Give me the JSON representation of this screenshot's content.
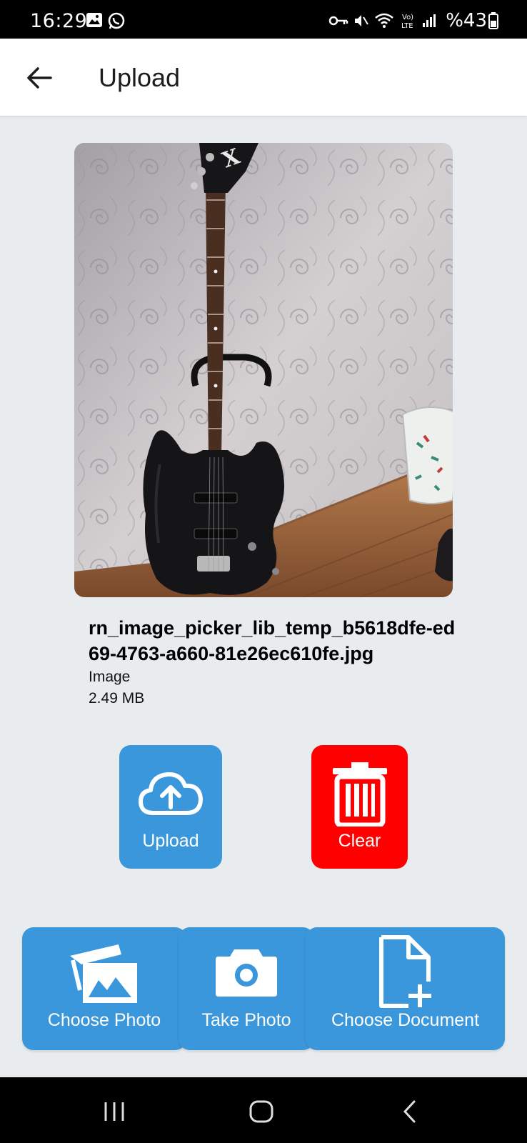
{
  "status_bar": {
    "time": "16:29",
    "battery": "%43",
    "icons": [
      "gallery-icon",
      "whatsapp-icon",
      "vpn-key-icon",
      "mute-icon",
      "wifi-icon",
      "volte-icon",
      "signal-icon",
      "battery-icon"
    ]
  },
  "header": {
    "title": "Upload",
    "back_icon": "arrow-left-icon"
  },
  "file": {
    "name": "rn_image_picker_lib_temp_b5618dfe-ed69-4763-a660-81e26ec610fe.jpg",
    "type": "Image",
    "size": "2.49 MB"
  },
  "actions": {
    "upload_label": "Upload",
    "clear_label": "Clear",
    "upload_color": "#3a97db",
    "clear_color": "#fe0000"
  },
  "sources": {
    "choose_photo_label": "Choose Photo",
    "take_photo_label": "Take Photo",
    "choose_document_label": "Choose Document"
  },
  "nav": {
    "icons": [
      "recent-apps-icon",
      "home-icon",
      "back-icon"
    ]
  }
}
